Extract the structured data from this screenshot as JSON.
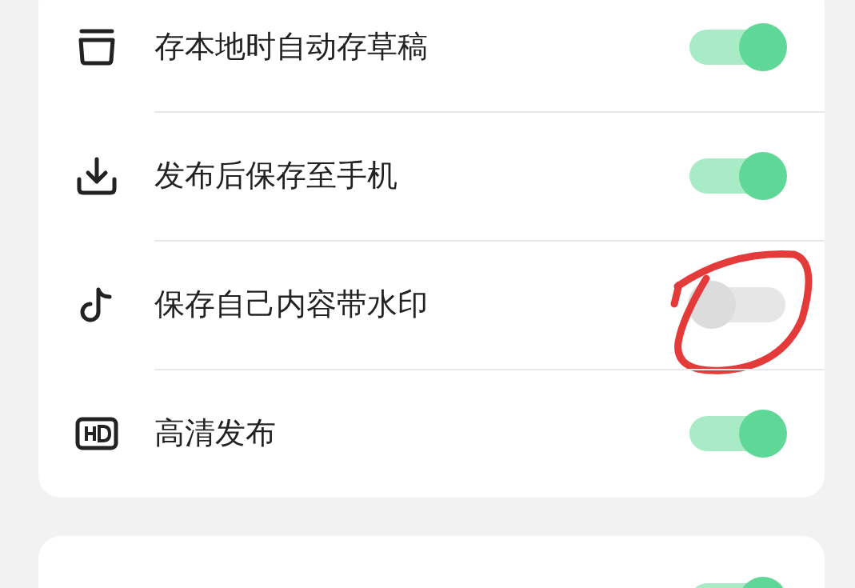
{
  "cards": [
    {
      "rows": [
        {
          "label": "存本地时自动存草稿",
          "on": true,
          "circled": false
        },
        {
          "label": "发布后保存至手机",
          "on": true,
          "circled": false
        },
        {
          "label": "保存自己内容带水印",
          "on": false,
          "circled": true
        },
        {
          "label": "高清发布",
          "on": true,
          "circled": false
        }
      ]
    },
    {
      "rows": [
        {
          "on": true,
          "circled": false
        }
      ]
    }
  ]
}
